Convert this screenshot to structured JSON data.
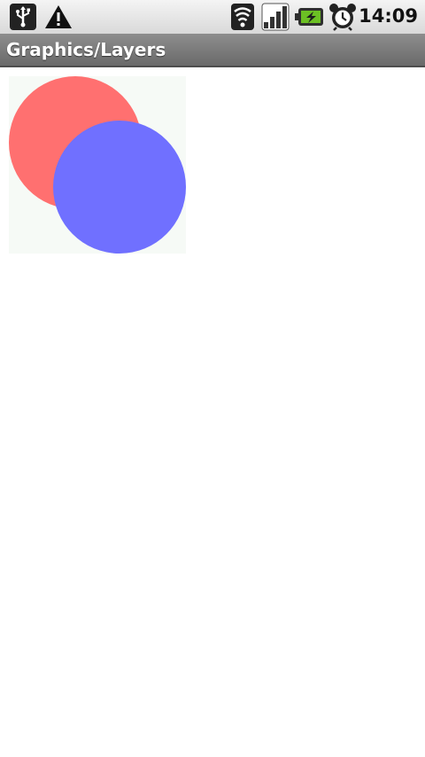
{
  "status_bar": {
    "time": "14:09",
    "icons": [
      "usb-icon",
      "warning-icon",
      "wifi-icon",
      "signal-icon",
      "battery-charging-icon",
      "alarm-icon"
    ]
  },
  "title_bar": {
    "title": "Graphics/Layers"
  },
  "canvas": {
    "background_color": "#f6faf6",
    "circles": [
      {
        "name": "red-circle",
        "color": "#ff7070"
      },
      {
        "name": "blue-circle",
        "color": "#7070ff"
      }
    ]
  }
}
